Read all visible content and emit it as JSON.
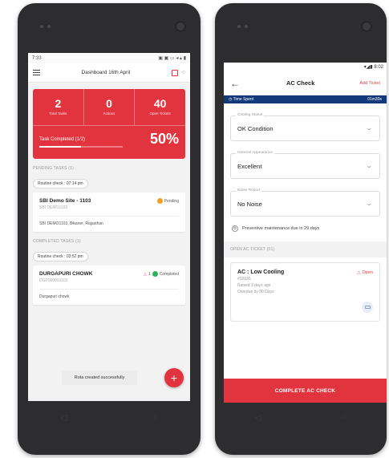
{
  "left": {
    "status_time": "7:33",
    "status_icons": "▣ ▣ ▭ ◂ ▴ ▮",
    "header_title": "Dashboard 16th April",
    "stats": [
      {
        "value": "2",
        "label": "Total Tasks"
      },
      {
        "value": "0",
        "label": "Actions"
      },
      {
        "value": "40",
        "label": "Open Tickets"
      }
    ],
    "task_completed_label": "Task Completed (1/2)",
    "task_completed_percent": "50%",
    "task_completed_fraction": 0.5,
    "pending_title": "PENDING TASKS (1)",
    "pending_chip": "Routine check : 07:14 pm",
    "pending_card": {
      "name": "SBI Demo Site - 1103",
      "code": "SBI DEMO1103",
      "status": "Pending",
      "status_color": "#f0a020",
      "location": "SBI DEMO1103, Bikaner, Rajasthan"
    },
    "completed_title": "COMPLETED TASKS (1)",
    "completed_chip": "Routine check : 03:52 pm",
    "completed_card": {
      "name": "DURGAPURI CHOWK",
      "code": "DGP000001103",
      "alert_count": "1",
      "status": "Completed",
      "status_color": "#2bb35a",
      "location": "Durgapuri chowk"
    },
    "toast": "Rota created successfully",
    "fab_symbol": "+"
  },
  "right": {
    "status_time": "8:02",
    "title": "AC Check",
    "add_ticket": "Add Ticket",
    "time_spent_label": "Time Spent",
    "time_spent_value": "01m30s",
    "fields": [
      {
        "label": "Cooling Status",
        "value": "OK Condition"
      },
      {
        "label": "General Appearance",
        "value": "Excellent"
      },
      {
        "label": "Noise Report",
        "value": "No Noise"
      }
    ],
    "maintenance_hint": "Preventive maintenance due in 29 days",
    "open_tickets_title": "OPEN AC TICKET (01)",
    "ticket": {
      "name": "AC : Low Cooling",
      "id": "#32035",
      "raised": "Raised 3 days ago",
      "overdue": "Overdue by 80 Days",
      "status": "Open"
    },
    "cta": "COMPLETE AC CHECK"
  },
  "colors": {
    "accent": "#e2343f",
    "timebar": "#123a7a",
    "phone": "#2d2d2f"
  }
}
